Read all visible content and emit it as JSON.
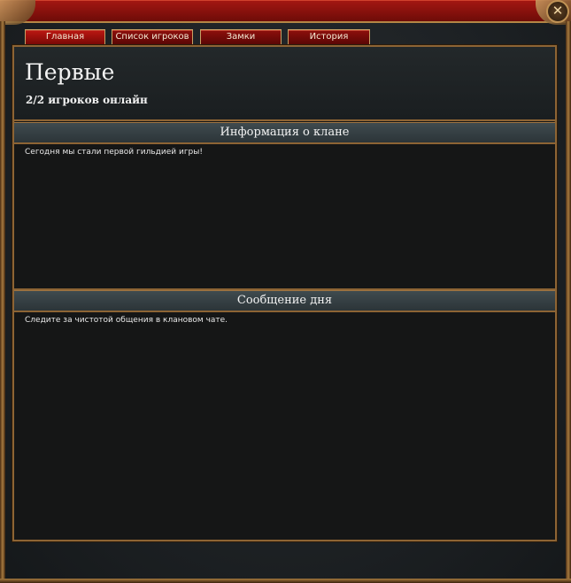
{
  "window": {
    "close_glyph": "✕"
  },
  "tabs": [
    {
      "label": "Главная",
      "active": true
    },
    {
      "label": "Список игроков",
      "active": false
    },
    {
      "label": "Замки",
      "active": false
    },
    {
      "label": "История",
      "active": false
    }
  ],
  "clan": {
    "name": "Первые",
    "online": "2/2 игроков онлайн"
  },
  "sections": {
    "info": {
      "title": "Информация о клане",
      "text": "Сегодня мы стали первой гильдией игры!"
    },
    "motd": {
      "title": "Сообщение дня",
      "text": "Следите за чистотой общения в клановом чате."
    }
  },
  "colors": {
    "title_bar": "#8a100b",
    "frame_gold": "#8d6434",
    "panel_bg": "#151616",
    "section_bar": "#354044"
  }
}
